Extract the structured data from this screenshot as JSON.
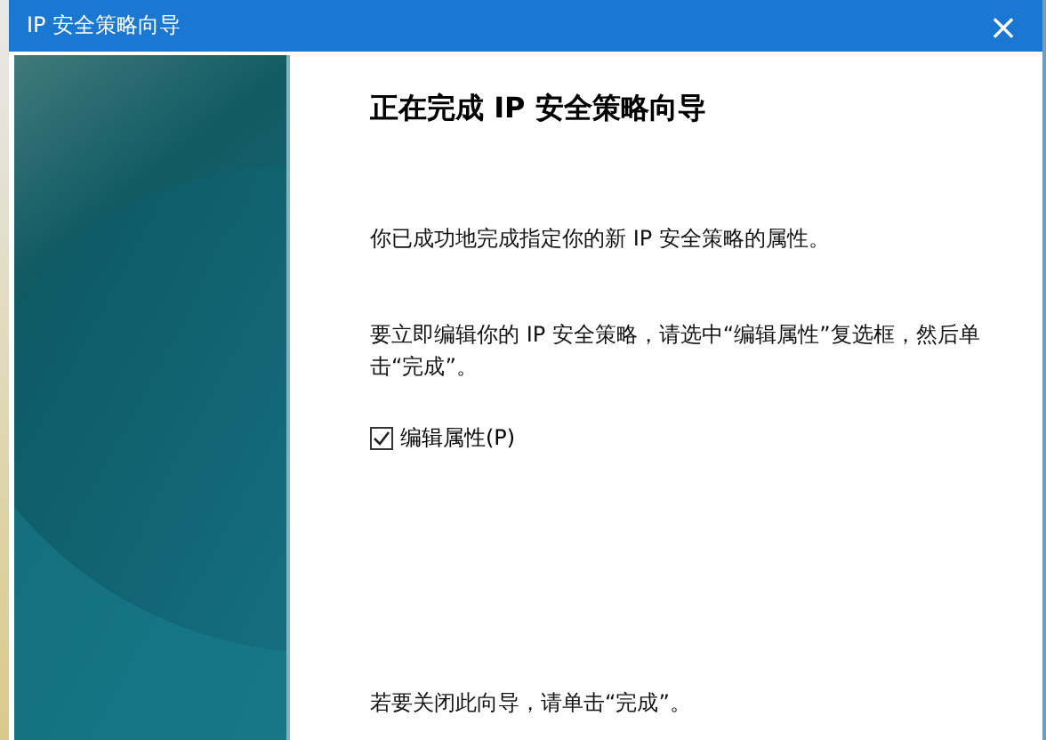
{
  "window": {
    "title": "IP 安全策略向导",
    "close": "×"
  },
  "heading": "正在完成 IP 安全策略向导",
  "paragraphs": [
    "你已成功地完成指定你的新 IP 安全策略的属性。",
    "要立即编辑你的 IP 安全策略，请选中“编辑属性”复选框，然后单击“完成”。"
  ],
  "checkbox": {
    "label": "编辑属性(P)",
    "checked": true
  },
  "footer_text": "若要关闭此向导，请单击“完成”。"
}
